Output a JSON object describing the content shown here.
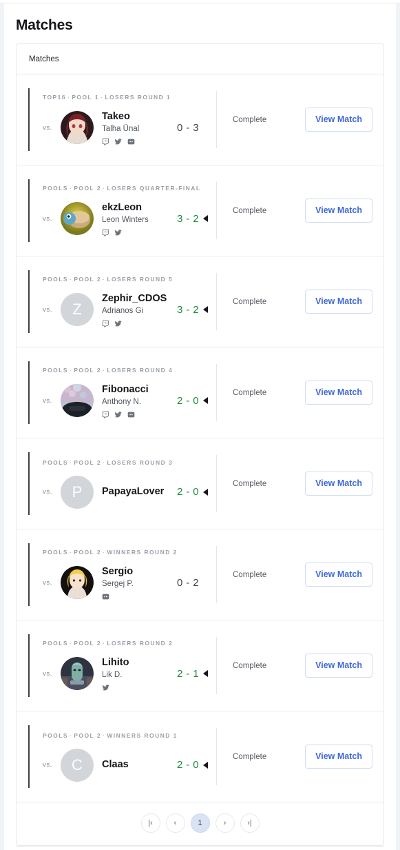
{
  "page": {
    "title": "Matches",
    "panel_header": "Matches"
  },
  "labels": {
    "vs": "vs.",
    "status_complete": "Complete",
    "view_match": "View Match"
  },
  "colors": {
    "win_green": "#1f8a3b",
    "link_blue": "#3f6ad8",
    "accent_bar": "#3c4047",
    "active_page": "#d9e3f5"
  },
  "matches": [
    {
      "round": "TOP16 · POOL 1 · LOSERS ROUND 1",
      "vs": "vs.",
      "avatar_type": "image",
      "avatar_kind": "takeo",
      "avatar_letter": "",
      "name": "Takeo",
      "real_name": "Talha Ünal",
      "socials": [
        "twitch-icon",
        "twitter-icon",
        "discord-icon"
      ],
      "score": "0 - 3",
      "result": "loss",
      "status": "Complete",
      "action": "View Match"
    },
    {
      "round": "POOLS · POOL 2 · LOSERS QUARTER-FINAL",
      "vs": "vs.",
      "avatar_type": "image",
      "avatar_kind": "ekzleon",
      "avatar_letter": "",
      "name": "ekzLeon",
      "real_name": "Leon Winters",
      "socials": [
        "twitch-icon",
        "twitter-icon"
      ],
      "score": "3 - 2",
      "result": "win",
      "status": "Complete",
      "action": "View Match"
    },
    {
      "round": "POOLS · POOL 2 · LOSERS ROUND 5",
      "vs": "vs.",
      "avatar_type": "letter",
      "avatar_kind": "",
      "avatar_letter": "Z",
      "name": "Zephir_CDOS",
      "real_name": "Adrianos Gi",
      "socials": [
        "twitch-icon",
        "twitter-icon"
      ],
      "score": "3 - 2",
      "result": "win",
      "status": "Complete",
      "action": "View Match"
    },
    {
      "round": "POOLS · POOL 2 · LOSERS ROUND 4",
      "vs": "vs.",
      "avatar_type": "image",
      "avatar_kind": "fibonacci",
      "avatar_letter": "",
      "name": "Fibonacci",
      "real_name": "Anthony N.",
      "socials": [
        "twitch-icon",
        "twitter-icon",
        "discord-icon"
      ],
      "score": "2 - 0",
      "result": "win",
      "status": "Complete",
      "action": "View Match"
    },
    {
      "round": "POOLS · POOL 2 · LOSERS ROUND 3",
      "vs": "vs.",
      "avatar_type": "letter",
      "avatar_kind": "",
      "avatar_letter": "P",
      "name": "PapayaLover",
      "real_name": "",
      "socials": [],
      "score": "2 - 0",
      "result": "win",
      "status": "Complete",
      "action": "View Match"
    },
    {
      "round": "POOLS · POOL 2 · WINNERS ROUND 2",
      "vs": "vs.",
      "avatar_type": "image",
      "avatar_kind": "sergio",
      "avatar_letter": "",
      "name": "Sergio",
      "real_name": "Sergej P.",
      "socials": [
        "discord-icon"
      ],
      "score": "0 - 2",
      "result": "loss",
      "status": "Complete",
      "action": "View Match"
    },
    {
      "round": "POOLS · POOL 2 · LOSERS ROUND 2",
      "vs": "vs.",
      "avatar_type": "image",
      "avatar_kind": "lihito",
      "avatar_letter": "",
      "name": "Lihito",
      "real_name": "Lik D.",
      "socials": [
        "twitter-icon"
      ],
      "score": "2 - 1",
      "result": "win",
      "status": "Complete",
      "action": "View Match"
    },
    {
      "round": "POOLS · POOL 2 · WINNERS ROUND 1",
      "vs": "vs.",
      "avatar_type": "letter",
      "avatar_kind": "",
      "avatar_letter": "C",
      "name": "Claas",
      "real_name": "",
      "socials": [],
      "score": "2 - 0",
      "result": "win",
      "status": "Complete",
      "action": "View Match"
    }
  ],
  "pagination": {
    "first_label": "|‹",
    "prev_label": "‹",
    "current_page": "1",
    "next_label": "›",
    "last_label": "›|"
  }
}
